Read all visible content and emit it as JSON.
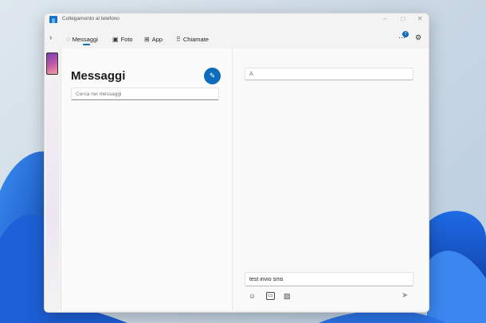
{
  "window": {
    "title": "Collegamento al telefono",
    "controls": {
      "minimize": "–",
      "maximize": "□",
      "close": "✕"
    }
  },
  "nav": {
    "expand_icon": "›",
    "tabs": [
      {
        "icon": "chat-icon",
        "glyph": "💬",
        "label": "Messaggi",
        "selected": true
      },
      {
        "icon": "photo-icon",
        "glyph": "🖼",
        "label": "Foto"
      },
      {
        "icon": "apps-icon",
        "glyph": "⊞",
        "label": "App"
      },
      {
        "icon": "dialpad-icon",
        "glyph": "⠿",
        "label": "Chiamate"
      }
    ],
    "notification_count": "7"
  },
  "messages": {
    "title": "Messaggi",
    "search_placeholder": "Cerca nei messaggi"
  },
  "conversation": {
    "to_placeholder": "A",
    "message_value": "test invio sms"
  },
  "colors": {
    "accent": "#0f6cbd"
  }
}
